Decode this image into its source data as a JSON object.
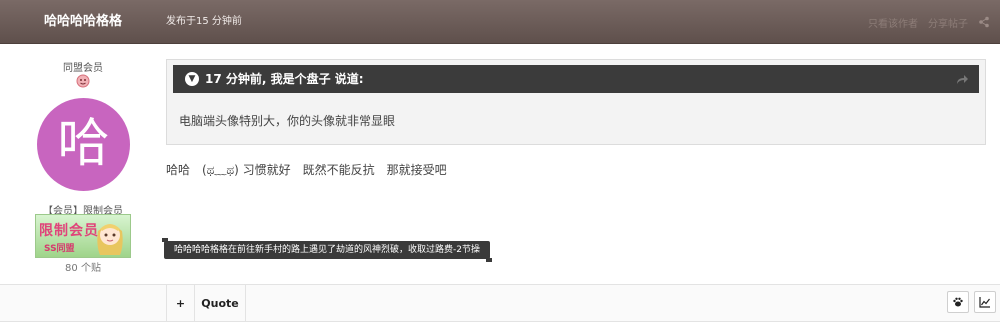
{
  "header": {
    "author": "哈哈哈哈格格",
    "posted_time": "发布于15 分钟前",
    "report_label": "只看该作者",
    "share_label": "分享帖子"
  },
  "profile": {
    "member_title": "同盟会员",
    "avatar_letter": "哈",
    "avatar_color": "#c865bf",
    "group_label": "【会员】限制会员",
    "badge_text": "限制会员",
    "badge_sub": "SS同盟",
    "post_count": "80 个贴"
  },
  "quote": {
    "header": "17 分钟前, 我是个盘子 说道:",
    "body": "电脑端头像特别大，你的头像就非常显眼"
  },
  "post": {
    "body": "哈哈　(ಥ﹏ಥ) 习惯就好　既然不能反抗　那就接受吧"
  },
  "notice": {
    "text": "哈哈哈哈格格在前往新手村的路上遇见了劫道的风神烈破，收取过路费-2节操"
  },
  "footer": {
    "plus_label": "+",
    "quote_label": "Quote"
  },
  "icons": [
    "share-icon",
    "chevron-down-icon",
    "quote-link-icon",
    "paw-icon",
    "chart-icon"
  ]
}
